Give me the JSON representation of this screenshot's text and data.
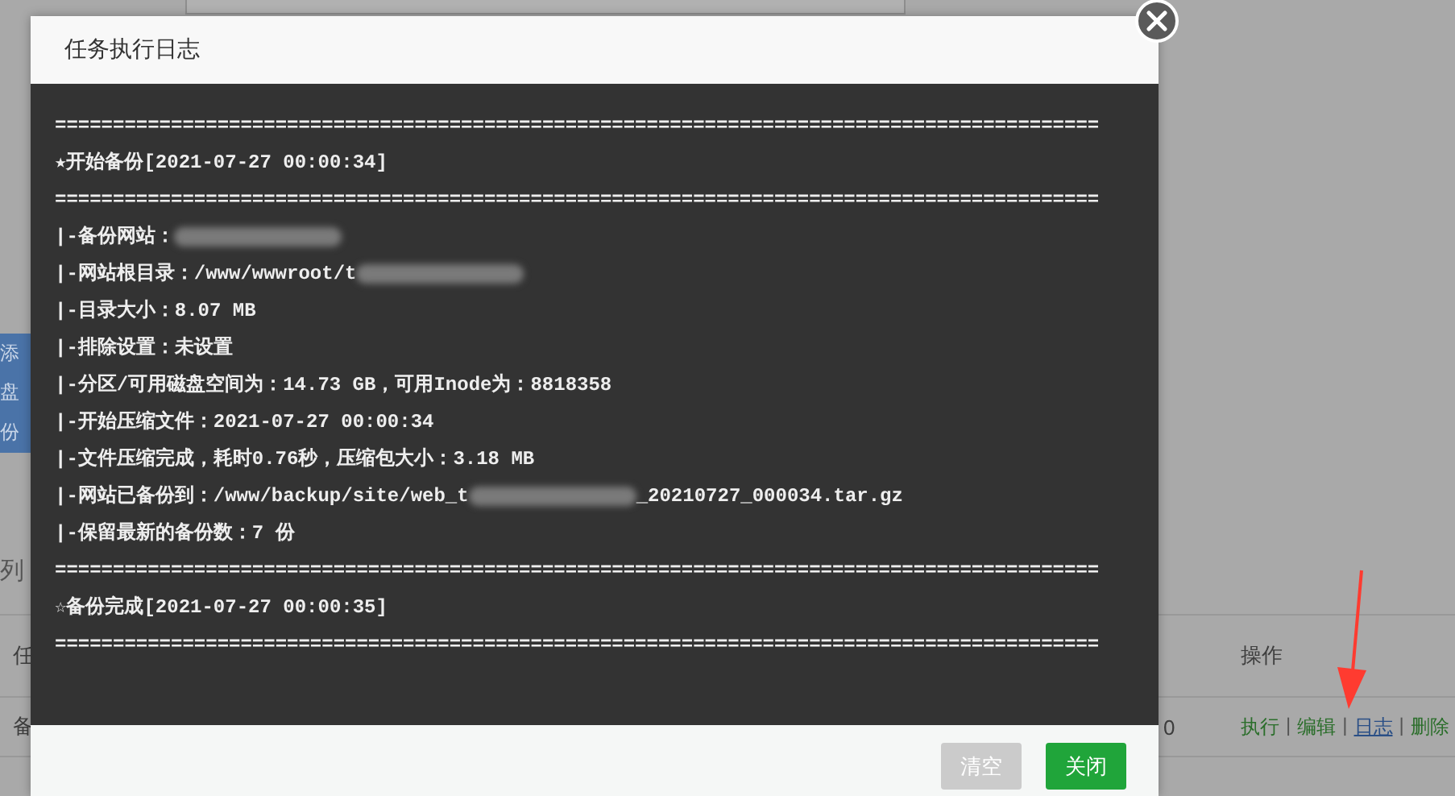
{
  "background": {
    "panel_texts": [
      "添",
      "盘",
      "份"
    ],
    "list_title": "列",
    "columns": [
      "任",
      "操作"
    ],
    "row": {
      "cells": [
        "备",
        "0"
      ],
      "separator": "|",
      "actions": [
        {
          "label": "执行",
          "highlighted": false
        },
        {
          "label": "编辑",
          "highlighted": false
        },
        {
          "label": "日志",
          "highlighted": true
        },
        {
          "label": "删除",
          "highlighted": false
        }
      ]
    }
  },
  "dialog": {
    "title": "任务执行日志",
    "log": [
      {
        "parts": [
          {
            "kind": "text",
            "text": "=========================================================================================="
          }
        ]
      },
      {
        "parts": [
          {
            "kind": "text",
            "text": "★开始备份[2021-07-27 00:00:34]"
          }
        ]
      },
      {
        "parts": [
          {
            "kind": "text",
            "text": "=========================================================================================="
          }
        ]
      },
      {
        "parts": [
          {
            "kind": "text",
            "text": "|-备份网站："
          },
          {
            "kind": "redacted"
          }
        ]
      },
      {
        "parts": [
          {
            "kind": "text",
            "text": "|-网站根目录：/www/wwwroot/t"
          },
          {
            "kind": "redacted"
          }
        ]
      },
      {
        "parts": [
          {
            "kind": "text",
            "text": "|-目录大小：8.07 MB"
          }
        ]
      },
      {
        "parts": [
          {
            "kind": "text",
            "text": "|-排除设置：未设置"
          }
        ]
      },
      {
        "parts": [
          {
            "kind": "text",
            "text": "|-分区/可用磁盘空间为：14.73 GB，可用Inode为：8818358"
          }
        ]
      },
      {
        "parts": [
          {
            "kind": "text",
            "text": "|-开始压缩文件：2021-07-27 00:00:34"
          }
        ]
      },
      {
        "parts": [
          {
            "kind": "text",
            "text": "|-文件压缩完成，耗时0.76秒，压缩包大小：3.18 MB"
          }
        ]
      },
      {
        "parts": [
          {
            "kind": "text",
            "text": "|-网站已备份到：/www/backup/site/web_t"
          },
          {
            "kind": "redacted"
          },
          {
            "kind": "text",
            "text": "_20210727_000034.tar.gz"
          }
        ]
      },
      {
        "parts": [
          {
            "kind": "text",
            "text": "|-保留最新的备份数：7 份"
          }
        ]
      },
      {
        "parts": [
          {
            "kind": "text",
            "text": "=========================================================================================="
          }
        ]
      },
      {
        "parts": [
          {
            "kind": "text",
            "text": "☆备份完成[2021-07-27 00:00:35]"
          }
        ]
      },
      {
        "parts": [
          {
            "kind": "text",
            "text": "=========================================================================================="
          }
        ]
      }
    ],
    "buttons": [
      {
        "label": "清空",
        "kind": "secondary"
      },
      {
        "label": "关闭",
        "kind": "primary"
      }
    ]
  }
}
